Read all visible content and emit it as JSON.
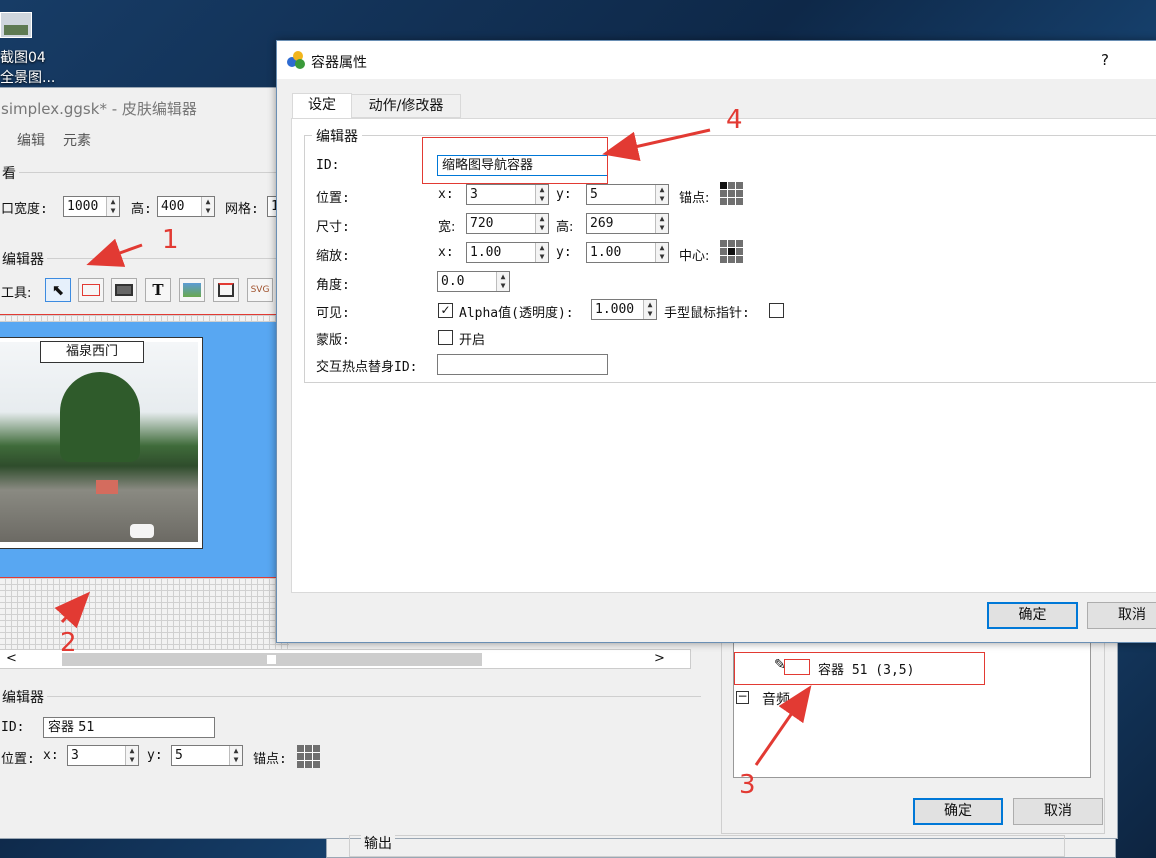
{
  "desktop": {
    "icon_label_1": "截图04",
    "icon_label_2": "全景图..."
  },
  "back_window": {
    "title": "simplex.ggsk* - 皮肤编辑器",
    "menu": [
      "编辑",
      "元素"
    ],
    "view_group": "看",
    "view_width_label": "口宽度:",
    "view_width_value": "1000",
    "view_height_label": "高:",
    "view_height_value": "400",
    "grid_label": "网格:",
    "grid_value": "1",
    "editor_group": "编辑器",
    "tools_label": "工具:",
    "canvas_tag": "福泉西门",
    "scroll_left": "<",
    "scroll_right": ">",
    "bottom_editor_group": "编辑器",
    "id_label": "ID:",
    "id_value": "容器 51",
    "pos_label": "位置:",
    "pos_x_label": "x:",
    "pos_x_value": "3",
    "pos_y_label": "y:",
    "pos_y_value": "5",
    "anchor_label": "锚点:",
    "tree_item": "容器 51 (3,5)",
    "tree_audio": "音频",
    "ok": "确定",
    "cancel": "取消",
    "output_group": "输出"
  },
  "dialog": {
    "title": "容器属性",
    "help": "?",
    "tabs": [
      {
        "label": "设定",
        "active": true
      },
      {
        "label": "动作/修改器",
        "active": false
      }
    ],
    "group_title": "编辑器",
    "id_label": "ID:",
    "id_value": "缩略图导航容器",
    "position": {
      "label": "位置:",
      "x_label": "x:",
      "x": "3",
      "y_label": "y:",
      "y": "5",
      "anchor_label": "锚点:"
    },
    "size": {
      "label": "尺寸:",
      "w_label": "宽:",
      "w": "720",
      "h_label": "高:",
      "h": "269"
    },
    "scale": {
      "label": "缩放:",
      "x_label": "x:",
      "x": "1.00",
      "y_label": "y:",
      "y": "1.00",
      "center_label": "中心:"
    },
    "angle": {
      "label": "角度:",
      "value": "0.0"
    },
    "visible": {
      "label": "可见:",
      "checked": true,
      "alpha_label": "Alpha值(透明度):",
      "alpha": "1.000",
      "cursor_label": "手型鼠标指针:"
    },
    "mask": {
      "label": "蒙版:",
      "checkbox_label": "开启"
    },
    "hotspot": {
      "label": "交互热点替身ID:",
      "value": ""
    },
    "ok": "确定",
    "cancel": "取消"
  },
  "annotations": [
    "1",
    "2",
    "3",
    "4"
  ],
  "colors": {
    "annotation": "#e23a33",
    "canvas": "#58a7f2",
    "focus": "#0078d7"
  }
}
